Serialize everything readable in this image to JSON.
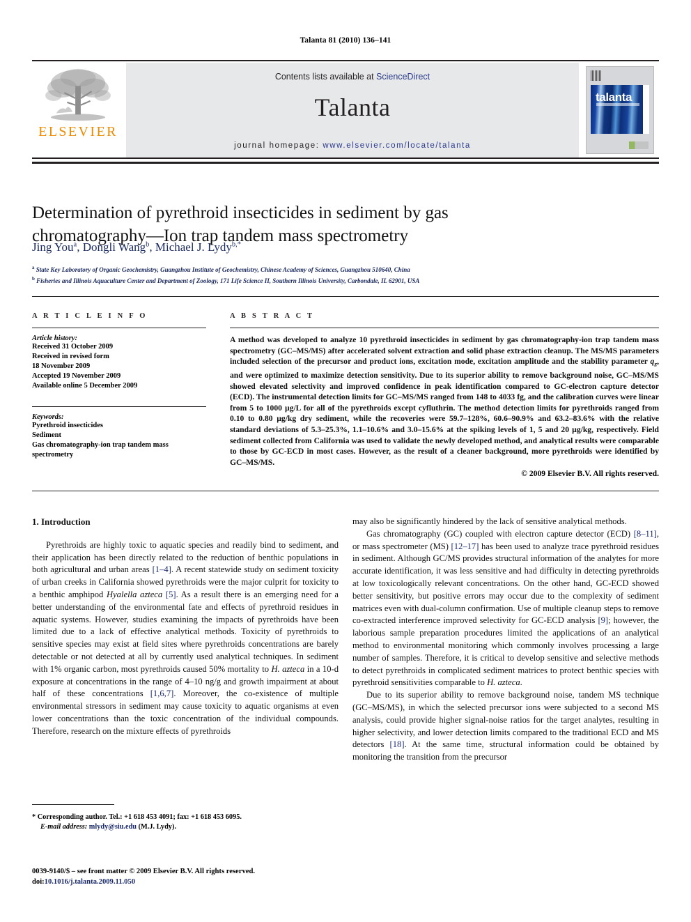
{
  "running_head": "Talanta 81 (2010) 136–141",
  "masthead": {
    "publisher_name": "ELSEVIER",
    "contents_prefix": "Contents lists available at ",
    "contents_link": "ScienceDirect",
    "journal_title": "Talanta",
    "homepage_prefix": "journal homepage: ",
    "homepage_url": "www.elsevier.com/locate/talanta",
    "cover_word": "talanta",
    "link_color": "#2b3a8c",
    "band_color": "#e7e8ea",
    "brand_color": "#ed8b00"
  },
  "article": {
    "title": "Determination of pyrethroid insecticides in sediment by gas chromatography—Ion trap tandem mass spectrometry",
    "authors_html": "Jing You<sup>a</sup>, Dongli Wang<sup>b</sup>, Michael J. Lydy<sup>b,</sup><sup>*</sup>",
    "affiliation_a": "State Key Laboratory of Organic Geochemistry, Guangzhou Institute of Geochemistry, Chinese Academy of Sciences, Guangzhou 510640, China",
    "affiliation_b": "Fisheries and Illinois Aquaculture Center and Department of Zoology, 171 Life Science II, Southern Illinois University, Carbondale, IL 62901, USA"
  },
  "article_info": {
    "heading": "A R T I C L E   I N F O",
    "history_label": "Article history:",
    "history": [
      "Received 31 October 2009",
      "Received in revised form",
      "18 November 2009",
      "Accepted 19 November 2009",
      "Available online 5 December 2009"
    ],
    "keywords_label": "Keywords:",
    "keywords": [
      "Pyrethroid insecticides",
      "Sediment",
      "Gas chromatography-ion trap tandem mass",
      "spectrometry"
    ]
  },
  "abstract": {
    "heading": "A B S T R A C T",
    "text": "A method was developed to analyze 10 pyrethroid insecticides in sediment by gas chromatography-ion trap tandem mass spectrometry (GC–MS/MS) after accelerated solvent extraction and solid phase extraction cleanup. The MS/MS parameters included selection of the precursor and product ions, excitation mode, excitation amplitude and the stability parameter qz, and were optimized to maximize detection sensitivity. Due to its superior ability to remove background noise, GC–MS/MS showed elevated selectivity and improved confidence in peak identification compared to GC-electron capture detector (ECD). The instrumental detection limits for GC–MS/MS ranged from 148 to 4033 fg, and the calibration curves were linear from 5 to 1000 µg/L for all of the pyrethroids except cyfluthrin. The method detection limits for pyrethroids ranged from 0.10 to 0.80 µg/kg dry sediment, while the recoveries were 59.7–128%, 60.6–90.9% and 63.2–83.6% with the relative standard deviations of 5.3–25.3%, 1.1–10.6% and 3.0–15.6% at the spiking levels of 1, 5 and 20 µg/kg, respectively. Field sediment collected from California was used to validate the newly developed method, and analytical results were comparable to those by GC-ECD in most cases. However, as the result of a cleaner background, more pyrethroids were identified by GC–MS/MS.",
    "copyright": "© 2009 Elsevier B.V. All rights reserved."
  },
  "body": {
    "section_heading": "1. Introduction",
    "left_paragraphs": [
      "Pyrethroids are highly toxic to aquatic species and readily bind to sediment, and their application has been directly related to the reduction of benthic populations in both agricultural and urban areas [1–4]. A recent statewide study on sediment toxicity of urban creeks in California showed pyrethroids were the major culprit for toxicity to a benthic amphipod Hyalella azteca [5]. As a result there is an emerging need for a better understanding of the environmental fate and effects of pyrethroid residues in aquatic systems. However, studies examining the impacts of pyrethroids have been limited due to a lack of effective analytical methods. Toxicity of pyrethroids to sensitive species may exist at field sites where pyrethroids concentrations are barely detectable or not detected at all by currently used analytical techniques. In sediment with 1% organic carbon, most pyrethroids caused 50% mortality to H. azteca in a 10-d exposure at concentrations in the range of 4–10 ng/g and growth impairment at about half of these concentrations [1,6,7]. Moreover, the co-existence of multiple environmental stressors in sediment may cause toxicity to aquatic organisms at even lower concentrations than the toxic concentration of the individual compounds. Therefore, research on the mixture effects of pyrethroids"
    ],
    "right_paragraphs": [
      "may also be significantly hindered by the lack of sensitive analytical methods.",
      "Gas chromatography (GC) coupled with electron capture detector (ECD) [8–11], or mass spectrometer (MS) [12–17] has been used to analyze trace pyrethroid residues in sediment. Although GC/MS provides structural information of the analytes for more accurate identification, it was less sensitive and had difficulty in detecting pyrethroids at low toxicologically relevant concentrations. On the other hand, GC-ECD showed better sensitivity, but positive errors may occur due to the complexity of sediment matrices even with dual-column confirmation. Use of multiple cleanup steps to remove co-extracted interference improved selectivity for GC-ECD analysis [9]; however, the laborious sample preparation procedures limited the applications of an analytical method to environmental monitoring which commonly involves processing a large number of samples. Therefore, it is critical to develop sensitive and selective methods to detect pyrethroids in complicated sediment matrices to protect benthic species with pyrethroid sensitivities comparable to H. azteca.",
      "Due to its superior ability to remove background noise, tandem MS technique (GC–MS/MS), in which the selected precursor ions were subjected to a second MS analysis, could provide higher signal-noise ratios for the target analytes, resulting in higher selectivity, and lower detection limits compared to the traditional ECD and MS detectors [18]. At the same time, structural information could be obtained by monitoring the transition from the precursor"
    ]
  },
  "footnotes": {
    "corresponding": "* Corresponding author. Tel.: +1 618 453 4091; fax: +1 618 453 6095.",
    "email_label": "E-mail address:",
    "email": "mlydy@siu.edu",
    "email_suffix": "(M.J. Lydy).",
    "issn_line": "0039-9140/$ – see front matter © 2009 Elsevier B.V. All rights reserved.",
    "doi_label": "doi:",
    "doi": "10.1016/j.talanta.2009.11.050"
  }
}
